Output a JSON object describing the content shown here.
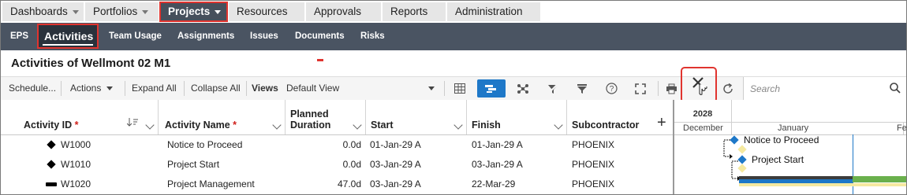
{
  "nav": {
    "tabs": [
      {
        "label": "Dashboards",
        "dropdown": true
      },
      {
        "label": "Portfolios",
        "dropdown": true
      },
      {
        "label": "Projects",
        "dropdown": true,
        "active": true
      },
      {
        "label": "Resources"
      },
      {
        "label": "Approvals"
      },
      {
        "label": "Reports"
      },
      {
        "label": "Administration"
      }
    ]
  },
  "subnav": {
    "items": [
      "EPS",
      "Activities",
      "Team Usage",
      "Assignments",
      "Issues",
      "Documents",
      "Risks"
    ],
    "active": "Activities"
  },
  "page_title": "Activities of Wellmont 02 M1",
  "toolbar": {
    "schedule": "Schedule...",
    "actions": "Actions",
    "expand_all": "Expand All",
    "collapse_all": "Collapse All",
    "views_label": "Views",
    "views_value": "Default View",
    "search_placeholder": "Search",
    "icons": [
      "grid-icon",
      "gantt-icon",
      "network-icon",
      "filter-off-icon",
      "filter-icon",
      "help-icon",
      "fullscreen-icon",
      "print-icon",
      "tools-icon",
      "refresh-icon",
      "search-icon"
    ]
  },
  "columns": {
    "activity_id": "Activity ID",
    "activity_name": "Activity Name",
    "planned_duration_line1": "Planned",
    "planned_duration_line2": "Duration",
    "start": "Start",
    "finish": "Finish",
    "subcontractor": "Subcontractor",
    "required_mark": "*"
  },
  "rows": [
    {
      "id": "W1000",
      "name": "Notice to Proceed",
      "duration": "0.0d",
      "start": "01-Jan-29 A",
      "finish": "01-Jan-29 A",
      "subcontractor": "PHOENIX",
      "type": "milestone"
    },
    {
      "id": "W1010",
      "name": "Project Start",
      "duration": "0.0d",
      "start": "03-Jan-29 A",
      "finish": "03-Jan-29 A",
      "subcontractor": "PHOENIX",
      "type": "milestone"
    },
    {
      "id": "W1020",
      "name": "Project Management",
      "duration": "47.0d",
      "start": "03-Jan-29 A",
      "finish": "22-Mar-29",
      "subcontractor": "PHOENIX",
      "type": "task"
    }
  ],
  "gantt": {
    "year": "2028",
    "months": [
      "December",
      "January",
      "Feb"
    ],
    "bar_labels": [
      "Notice to Proceed",
      "Project Start"
    ]
  },
  "colors": {
    "accent_blue": "#1e78c8",
    "highlight_red": "#e0342f",
    "subnav_bg": "#4a5462"
  }
}
